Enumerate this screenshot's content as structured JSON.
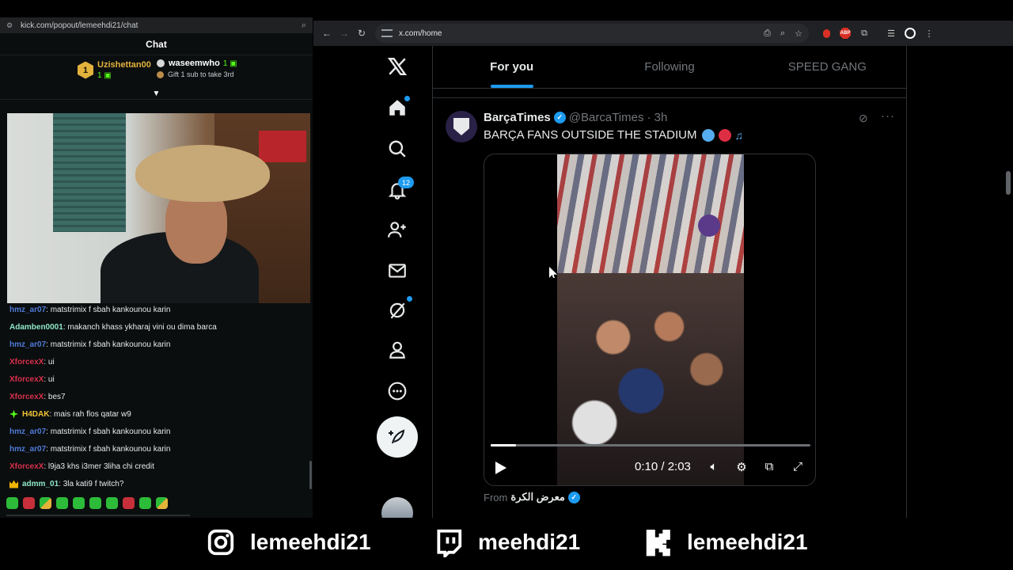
{
  "kick": {
    "url": "kick.com/popout/lemeehdi21/chat",
    "header": "Chat",
    "leaderboard": {
      "first_rank": "1",
      "first_name": "Uzishettan00",
      "first_count": "1",
      "second_name": "waseemwho",
      "second_count": "1",
      "gift_text": "Gift 1 sub to take 3rd"
    },
    "messages": [
      {
        "user": "hmz_ar07",
        "color": "#4f7bd9",
        "text": ": matstrimix f sbah kankounou karin"
      },
      {
        "user": "Adamben0001",
        "color": "#8ee6c6",
        "text": ": makanch khass ykharaj vini ou dima barca"
      },
      {
        "user": "hmz_ar07",
        "color": "#4f7bd9",
        "text": ": matstrimix f sbah kankounou karin"
      },
      {
        "user": "XforcexX",
        "color": "#d9304b",
        "text": ": ui"
      },
      {
        "user": "XforcexX",
        "color": "#d9304b",
        "text": ": ui"
      },
      {
        "user": "XforcexX",
        "color": "#d9304b",
        "text": ": bes7"
      },
      {
        "user": "H4DAK",
        "color": "#f0c438",
        "text": ": mais rah flos qatar w9",
        "badge": "star"
      },
      {
        "user": "hmz_ar07",
        "color": "#4f7bd9",
        "text": ": matstrimix f sbah kankounou karin"
      },
      {
        "user": "hmz_ar07",
        "color": "#4f7bd9",
        "text": ": matstrimix f sbah kankounou karin"
      },
      {
        "user": "XforcexX",
        "color": "#d9304b",
        "text": ": l9ja3 khs i3mer 3liha chi credit"
      },
      {
        "user": "admm_01",
        "color": "#8ee6c6",
        "text": ": 3la kati9 f twitch?",
        "badge": "crown"
      }
    ]
  },
  "browser": {
    "url": "x.com/home"
  },
  "x": {
    "notifications_count": "12",
    "tabs": [
      "For you",
      "Following",
      "SPEED GANG"
    ],
    "tweet": {
      "name": "BarçaTimes",
      "handle": "@BarcaTimes",
      "time": "· 3h",
      "text": "BARÇA FANS OUTSIDE THE STADIUM",
      "video_time": "0:10 / 2:03",
      "video_progress": 0.08,
      "from_label": "From",
      "from_source": "معرض الكرة"
    }
  },
  "social": {
    "instagram": "lemeehdi21",
    "twitch": "meehdi21",
    "kick": "lemeehdi21"
  }
}
